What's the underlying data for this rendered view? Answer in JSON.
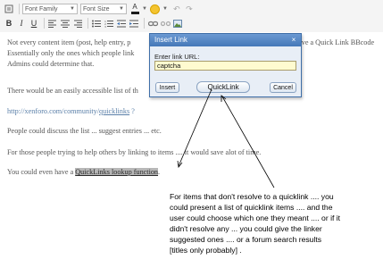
{
  "toolbar": {
    "font_family": "Font Family",
    "font_size": "Font Size",
    "bold": "B",
    "italic": "I",
    "underline": "U",
    "color_a": "A",
    "row1_icons": [
      "source-icon",
      "remove-format-icon",
      "font-color-icon",
      "smiley-icon",
      "undo-icon",
      "redo-icon"
    ],
    "row2_icons": [
      "bold-icon",
      "italic-icon",
      "underline-icon",
      "align-left-icon",
      "align-center-icon",
      "align-right-icon",
      "bullet-list-icon",
      "numbered-list-icon",
      "outdent-icon",
      "indent-icon",
      "link-icon",
      "unlink-icon",
      "image-icon"
    ]
  },
  "editor": {
    "p1_line1_start": "Not every content item (post, help entry, p",
    "p1_line1_end": "have a Quick Link BBcode",
    "p1_line2_start": "Essentially only the ones which people link",
    "p1_line3": "Admins could determine that.",
    "p2_start": "There would be an easily accessible list of th",
    "link_prefix": "http://xenforo.com/community/",
    "link_word": "quicklinks",
    "link_suffix": " ?",
    "p3": "People could discuss the list ... suggest entries ... etc.",
    "p4": "For those people trying to help others by linking to items .... it would save alot of time.",
    "p5_prefix": "You could even have a ",
    "p5_highlight": "QuickLinks lookup function",
    "p5_suffix": "."
  },
  "modal": {
    "title": "Insert Link",
    "close_glyph": "×",
    "field_label": "Enter link URL:",
    "url_value": "captcha",
    "insert_label": "Insert",
    "quicklink_label": "QuickLink",
    "cancel_label": "Cancel"
  },
  "annotation": {
    "lines": [
      "For items that don't resolve to a quicklink .... you",
      "could present a list of quicklink items .... and the",
      "user could choose which one they meant .... or if it",
      "didn't resolve any ... you could give the linker",
      "suggested ones .... or a forum search results",
      "[titles only probably] ."
    ]
  },
  "colors": {
    "modal_title_bar": "#4578b8",
    "input_background": "#fffbd0",
    "link_text": "#5a7fa8",
    "highlight": "#b7b7b7"
  }
}
